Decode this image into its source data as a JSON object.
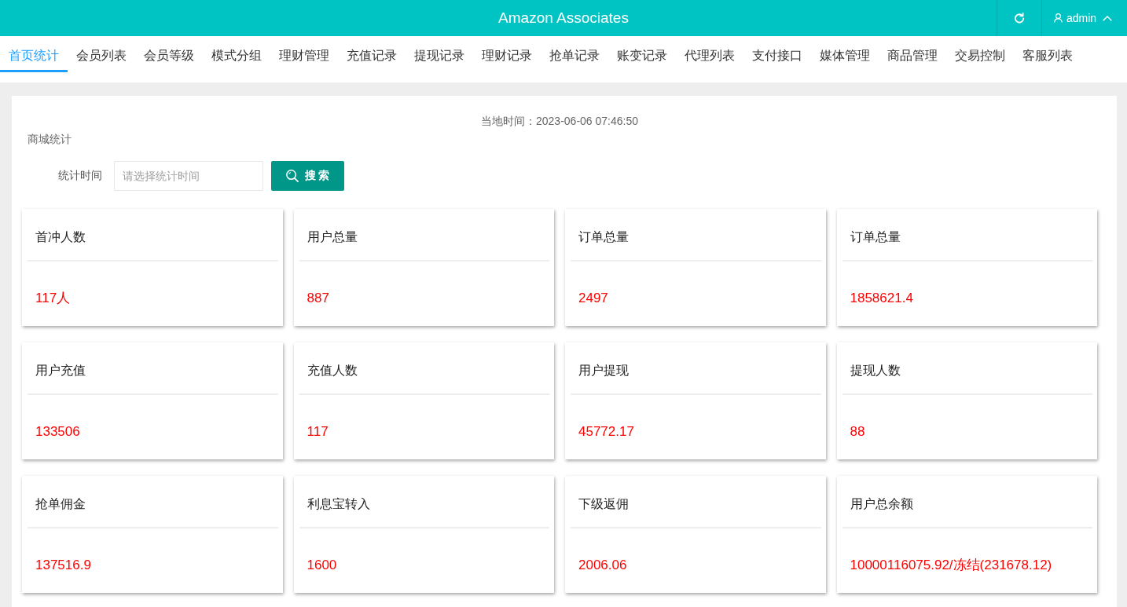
{
  "header": {
    "title": "Amazon Associates",
    "user": "admin"
  },
  "tabs": [
    {
      "label": "首页统计",
      "selected": true
    },
    {
      "label": "会员列表",
      "selected": false
    },
    {
      "label": "会员等级",
      "selected": false
    },
    {
      "label": "模式分组",
      "selected": false
    },
    {
      "label": "理财管理",
      "selected": false
    },
    {
      "label": "充值记录",
      "selected": false
    },
    {
      "label": "提现记录",
      "selected": false
    },
    {
      "label": "理财记录",
      "selected": false
    },
    {
      "label": "抢单记录",
      "selected": false
    },
    {
      "label": "账变记录",
      "selected": false
    },
    {
      "label": "代理列表",
      "selected": false
    },
    {
      "label": "支付接口",
      "selected": false
    },
    {
      "label": "媒体管理",
      "selected": false
    },
    {
      "label": "商品管理",
      "selected": false
    },
    {
      "label": "交易控制",
      "selected": false
    },
    {
      "label": "客服列表",
      "selected": false
    }
  ],
  "panel": {
    "local_time": "当地时间：2023-06-06 07:46:50",
    "section_title": "商城统计"
  },
  "filter": {
    "label": "统计时间",
    "placeholder": "请选择统计时间",
    "button": "搜 索"
  },
  "stats": [
    {
      "title": "首冲人数",
      "value": "117人"
    },
    {
      "title": "用户总量",
      "value": "887"
    },
    {
      "title": "订单总量",
      "value": "2497"
    },
    {
      "title": "订单总量",
      "value": "1858621.4"
    },
    {
      "title": "用户充值",
      "value": "133506"
    },
    {
      "title": "充值人数",
      "value": "117"
    },
    {
      "title": "用户提现",
      "value": "45772.17"
    },
    {
      "title": "提现人数",
      "value": "88"
    },
    {
      "title": "抢单佣金",
      "value": "137516.9"
    },
    {
      "title": "利息宝转入",
      "value": "1600"
    },
    {
      "title": "下级返佣",
      "value": "2006.06"
    },
    {
      "title": "用户总余额",
      "value": "10000116075.92/冻结(231678.12)"
    }
  ]
}
